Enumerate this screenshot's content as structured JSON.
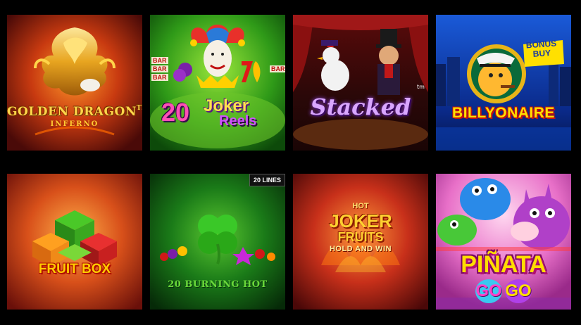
{
  "games": [
    {
      "id": "golden-dragon",
      "title": "GOLDEN DRAGON",
      "tm": "TM",
      "subtitle": "INFERNO"
    },
    {
      "id": "joker-reels",
      "number": "20",
      "title": "Joker",
      "subtitle": "Reels",
      "bar_label": "BAR"
    },
    {
      "id": "stacked",
      "title": "Stacked",
      "tm": "tm"
    },
    {
      "id": "billyonaire",
      "title": "BILLYONAIRE",
      "badge_line1": "BONUS",
      "badge_line2": "BUY"
    },
    {
      "id": "fruit-box",
      "title": "FRUIT BOX"
    },
    {
      "id": "burning-hot",
      "title": "20 BURNING HOT",
      "lines_badge": "20 LINES"
    },
    {
      "id": "hot-joker-fruits",
      "pre": "HOT",
      "title": "JOKER",
      "title2": "FRUITS",
      "subtitle": "HOLD AND WIN"
    },
    {
      "id": "pinata-gogo",
      "title": "PIÑATA",
      "go1": "GO",
      "go2": "GO"
    }
  ],
  "colors": {
    "background": "#000000",
    "gold": "#ffd54a",
    "pink": "#ff4fb5",
    "purple": "#d9a6ff",
    "billy_yellow": "#ffe000",
    "green": "#6ad83a"
  }
}
